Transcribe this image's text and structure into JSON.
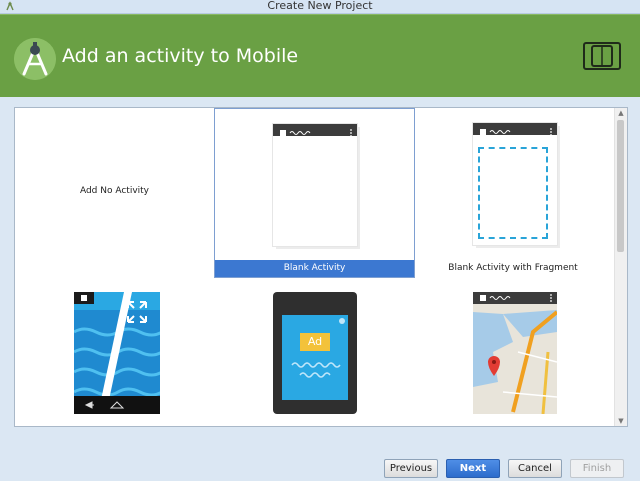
{
  "window": {
    "title": "Create New Project"
  },
  "header": {
    "title": "Add an activity to Mobile"
  },
  "gallery": {
    "tiles": [
      {
        "label": "Add No Activity",
        "selected": false
      },
      {
        "label": "Blank Activity",
        "selected": true
      },
      {
        "label": "Blank Activity with Fragment",
        "selected": false
      },
      {
        "label": "",
        "selected": false
      },
      {
        "label": "",
        "selected": false
      },
      {
        "label": "",
        "selected": false
      }
    ],
    "ad_badge": "Ad"
  },
  "buttons": {
    "previous": "Previous",
    "next": "Next",
    "cancel": "Cancel",
    "finish": "Finish"
  },
  "colors": {
    "header": "#6aa044",
    "selection": "#3c78d1",
    "primary_button": "#2c6ccc"
  }
}
